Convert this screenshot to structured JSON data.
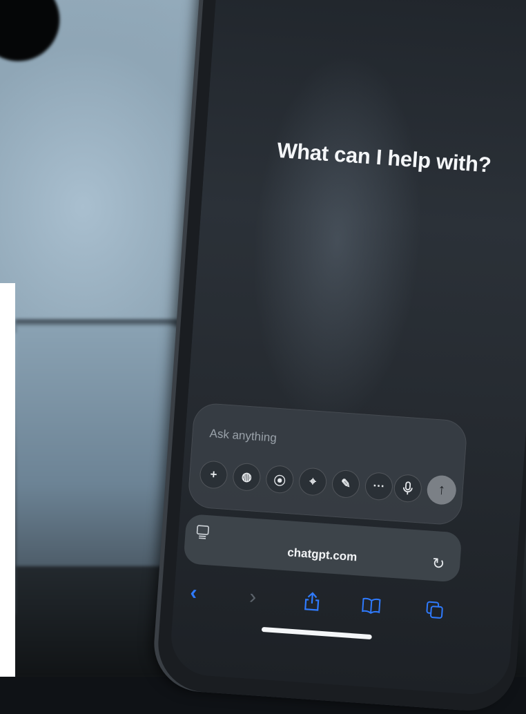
{
  "screen": {
    "title": "What can I help with?",
    "composer": {
      "placeholder": "Ask anything",
      "tools": [
        {
          "icon": "plus-icon",
          "glyph": "+"
        },
        {
          "icon": "globe-icon",
          "glyph": "◍"
        },
        {
          "icon": "map-pin-icon",
          "glyph": "⦿"
        },
        {
          "icon": "telescope-icon",
          "glyph": "⌖"
        },
        {
          "icon": "paint-palette-icon",
          "glyph": "✎"
        },
        {
          "icon": "more-icon",
          "glyph": "···"
        }
      ],
      "mic_icon": "microphone-icon",
      "send_glyph": "↑"
    },
    "browser": {
      "url": "chatgpt.com",
      "reload_glyph": "↻",
      "back_glyph": "‹",
      "forward_glyph": "›",
      "accent": "#2f7bff"
    }
  }
}
